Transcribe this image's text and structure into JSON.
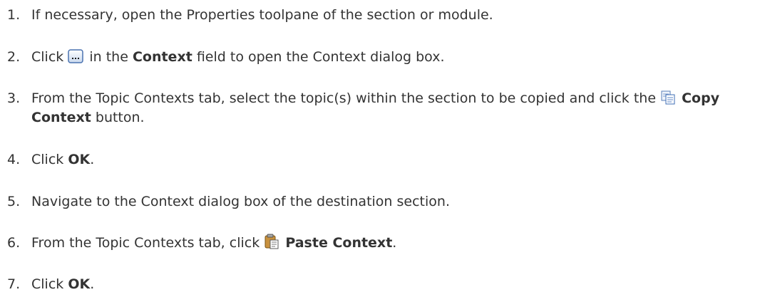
{
  "steps": [
    {
      "number": "1.",
      "segments": [
        {
          "text": "If necessary, open the Properties toolpane of the section or module."
        }
      ]
    },
    {
      "number": "2.",
      "segments": [
        {
          "text": "Click "
        },
        {
          "icon": "ellipsis-button-icon"
        },
        {
          "text": " in the "
        },
        {
          "text": "Context",
          "bold": true
        },
        {
          "text": " field to open the Context dialog box."
        }
      ]
    },
    {
      "number": "3.",
      "segments": [
        {
          "text": "From the Topic Contexts tab, select the topic(s) within the section to be copied and click the "
        },
        {
          "icon": "copy-context-icon"
        },
        {
          "text": " "
        },
        {
          "text": "Copy Context",
          "bold": true
        },
        {
          "text": " button."
        }
      ]
    },
    {
      "number": "4.",
      "segments": [
        {
          "text": "Click "
        },
        {
          "text": "OK",
          "bold": true
        },
        {
          "text": "."
        }
      ]
    },
    {
      "number": "5.",
      "segments": [
        {
          "text": "Navigate to the Context dialog box of the destination section."
        }
      ]
    },
    {
      "number": "6.",
      "segments": [
        {
          "text": "From the Topic Contexts tab, click "
        },
        {
          "icon": "paste-context-icon"
        },
        {
          "text": " "
        },
        {
          "text": "Paste Context",
          "bold": true
        },
        {
          "text": "."
        }
      ]
    },
    {
      "number": "7.",
      "segments": [
        {
          "text": "Click "
        },
        {
          "text": "OK",
          "bold": true
        },
        {
          "text": "."
        }
      ]
    }
  ]
}
